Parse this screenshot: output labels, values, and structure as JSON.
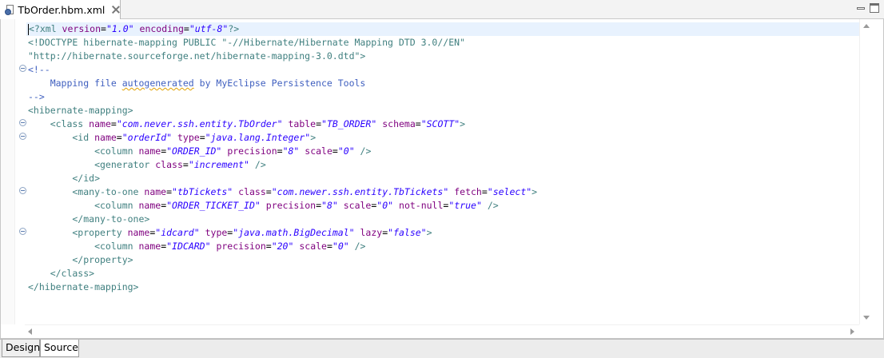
{
  "editor_tab": {
    "title": "TbOrder.hbm.xml",
    "icon": "xml-file-icon"
  },
  "bottom_tabs": {
    "design": "Design",
    "source": "Source"
  },
  "colors": {
    "tag": "#3f7f7f",
    "attribute": "#7f007f",
    "value": "#2a00ff",
    "comment": "#3f5fbf",
    "current_line": "#e8f2fe"
  },
  "code": {
    "l1": {
      "t1": "<?xml ",
      "a1": "version",
      "p1": "=",
      "v1": "\"1.0\"",
      "s1": " ",
      "a2": "encoding",
      "p2": "=",
      "v2": "\"utf-8\"",
      "t2": "?>"
    },
    "l2": "<!DOCTYPE hibernate-mapping PUBLIC \"-//Hibernate/Hibernate Mapping DTD 3.0//EN\"",
    "l3": "\"http://hibernate.sourceforge.net/hibernate-mapping-3.0.dtd\">",
    "l4": "<!--",
    "l5": {
      "pre": "    Mapping file ",
      "u": "autogenerated",
      "post": " by MyEclipse Persistence Tools"
    },
    "l6": "-->",
    "l7": "<hibernate-mapping>",
    "l8": {
      "t1": "    <class ",
      "a1": "name",
      "v1": "\"com.never.ssh.entity.TbOrder\"",
      "a2": "table",
      "v2": "\"TB_ORDER\"",
      "a3": "schema",
      "v3": "\"SCOTT\"",
      "t2": ">"
    },
    "l9": {
      "t1": "        <id ",
      "a1": "name",
      "v1": "\"orderId\"",
      "a2": "type",
      "v2": "\"java.lang.Integer\"",
      "t2": ">"
    },
    "l10": {
      "t1": "            <column ",
      "a1": "name",
      "v1": "\"ORDER_ID\"",
      "a2": "precision",
      "v2": "\"8\"",
      "a3": "scale",
      "v3": "\"0\"",
      "t2": " />"
    },
    "l11": {
      "t1": "            <generator ",
      "a1": "class",
      "v1": "\"increment\"",
      "t2": " />"
    },
    "l12": "        </id>",
    "l13": {
      "t1": "        <many-to-one ",
      "a1": "name",
      "v1": "\"tbTickets\"",
      "a2": "class",
      "v2": "\"com.newer.ssh.entity.TbTickets\"",
      "a3": "fetch",
      "v3": "\"select\"",
      "t2": ">"
    },
    "l14": {
      "t1": "            <column ",
      "a1": "name",
      "v1": "\"ORDER_TICKET_ID\"",
      "a2": "precision",
      "v2": "\"8\"",
      "a3": "scale",
      "v3": "\"0\"",
      "a4": "not-null",
      "v4": "\"true\"",
      "t2": " />"
    },
    "l15": "        </many-to-one>",
    "l16": {
      "t1": "        <property ",
      "a1": "name",
      "v1": "\"idcard\"",
      "a2": "type",
      "v2": "\"java.math.BigDecimal\"",
      "a3": "lazy",
      "v3": "\"false\"",
      "t2": ">"
    },
    "l17": {
      "t1": "            <column ",
      "a1": "name",
      "v1": "\"IDCARD\"",
      "a2": "precision",
      "v2": "\"20\"",
      "a3": "scale",
      "v3": "\"0\"",
      "t2": " />"
    },
    "l18": "        </property>",
    "l19": "    </class>",
    "l20": "</hibernate-mapping>"
  },
  "eq": "=",
  "sp": " "
}
